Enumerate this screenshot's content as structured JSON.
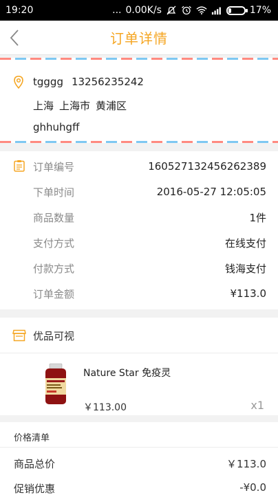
{
  "status_bar": {
    "time": "19:20",
    "dots": "...",
    "network_speed": "0.00K/s",
    "battery_percent": "17%",
    "battery_level": 0.17,
    "icons": [
      "alarm-off-icon",
      "alarm-clock-icon",
      "wifi-icon",
      "signal-icon",
      "battery-icon"
    ]
  },
  "nav": {
    "title": "订单详情",
    "back_icon": "chevron-left-icon"
  },
  "colors": {
    "accent": "#f5a623",
    "stripe_red": "#ff8a80",
    "stripe_blue": "#7ec8f2"
  },
  "address": {
    "icon": "location-pin-icon",
    "name": "tgggg",
    "phone": "13256235242",
    "province": "上海",
    "city": "上海市",
    "district": "黄浦区",
    "detail": "ghhuhgff"
  },
  "order": {
    "icon": "clipboard-icon",
    "rows": [
      {
        "label": "订单编号",
        "value": "160527132456262389"
      },
      {
        "label": "下单时间",
        "value": "2016-05-27 12:05:05"
      },
      {
        "label": "商品数量",
        "value": "1件"
      },
      {
        "label": "支付方式",
        "value": "在线支付"
      },
      {
        "label": "付款方式",
        "value": "钱海支付"
      },
      {
        "label": "订单金额",
        "value": "¥113.0"
      }
    ]
  },
  "goods": {
    "icon": "shop-icon",
    "title": "优品可视",
    "items": [
      {
        "name": "Nature Star 免疫灵",
        "price": "￥113.00",
        "qty": "x1"
      }
    ]
  },
  "price_list": {
    "title": "价格清单",
    "rows": [
      {
        "label": "商品总价",
        "value": "￥113.0"
      },
      {
        "label": "促销优惠",
        "value": "-¥0.0"
      }
    ]
  }
}
